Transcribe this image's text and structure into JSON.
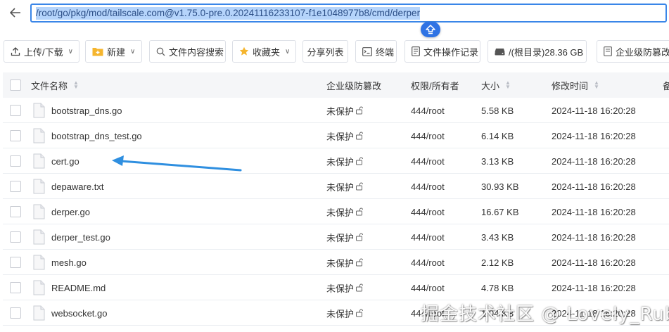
{
  "path_bar": {
    "path": "/root/go/pkg/mod/tailscale.com@v1.75.0-pre.0.20241116233107-f1e1048977b8/cmd/derper"
  },
  "toolbar": {
    "upload": "上传/下载",
    "new": "新建",
    "search": "文件内容搜索",
    "favorites": "收藏夹",
    "share_list": "分享列表",
    "terminal": "终端",
    "op_log": "文件操作记录",
    "disk": "/(根目录)28.36 GB",
    "tamper": "企业级防篡改"
  },
  "columns": {
    "name": "文件名称",
    "tamper": "企业级防篡改",
    "perm": "权限/所有者",
    "size": "大小",
    "mtime": "修改时间",
    "extra": "备"
  },
  "files": [
    {
      "name": "bootstrap_dns.go",
      "tamper": "未保护",
      "perm": "444/root",
      "size": "5.58 KB",
      "mtime": "2024-11-18 16:20:28"
    },
    {
      "name": "bootstrap_dns_test.go",
      "tamper": "未保护",
      "perm": "444/root",
      "size": "6.14 KB",
      "mtime": "2024-11-18 16:20:28"
    },
    {
      "name": "cert.go",
      "tamper": "未保护",
      "perm": "444/root",
      "size": "3.13 KB",
      "mtime": "2024-11-18 16:20:28"
    },
    {
      "name": "depaware.txt",
      "tamper": "未保护",
      "perm": "444/root",
      "size": "30.93 KB",
      "mtime": "2024-11-18 16:20:28"
    },
    {
      "name": "derper.go",
      "tamper": "未保护",
      "perm": "444/root",
      "size": "16.67 KB",
      "mtime": "2024-11-18 16:20:28"
    },
    {
      "name": "derper_test.go",
      "tamper": "未保护",
      "perm": "444/root",
      "size": "3.43 KB",
      "mtime": "2024-11-18 16:20:28"
    },
    {
      "name": "mesh.go",
      "tamper": "未保护",
      "perm": "444/root",
      "size": "2.12 KB",
      "mtime": "2024-11-18 16:20:28"
    },
    {
      "name": "README.md",
      "tamper": "未保护",
      "perm": "444/root",
      "size": "4.78 KB",
      "mtime": "2024-11-18 16:20:28"
    },
    {
      "name": "websocket.go",
      "tamper": "未保护",
      "perm": "444/root",
      "size": "1.04 KB",
      "mtime": "2024-11-18 16:20:28"
    }
  ],
  "watermark": "掘金技术社区 @ Lovely_Ruby",
  "colors": {
    "accent": "#2f73e4",
    "annotation_arrow": "#2f8fe0",
    "folder_icon": "#f5b52e"
  },
  "icons": {
    "back": "arrow-left-icon",
    "up": "up-directory-icon",
    "upload": "upload-icon",
    "new": "folder-plus-icon",
    "search": "search-icon",
    "favorites": "star-icon",
    "terminal": "terminal-icon",
    "op_log": "document-log-icon",
    "disk": "hard-drive-icon",
    "tamper": "shield-icon",
    "file": "file-icon",
    "lock": "unlock-icon"
  }
}
